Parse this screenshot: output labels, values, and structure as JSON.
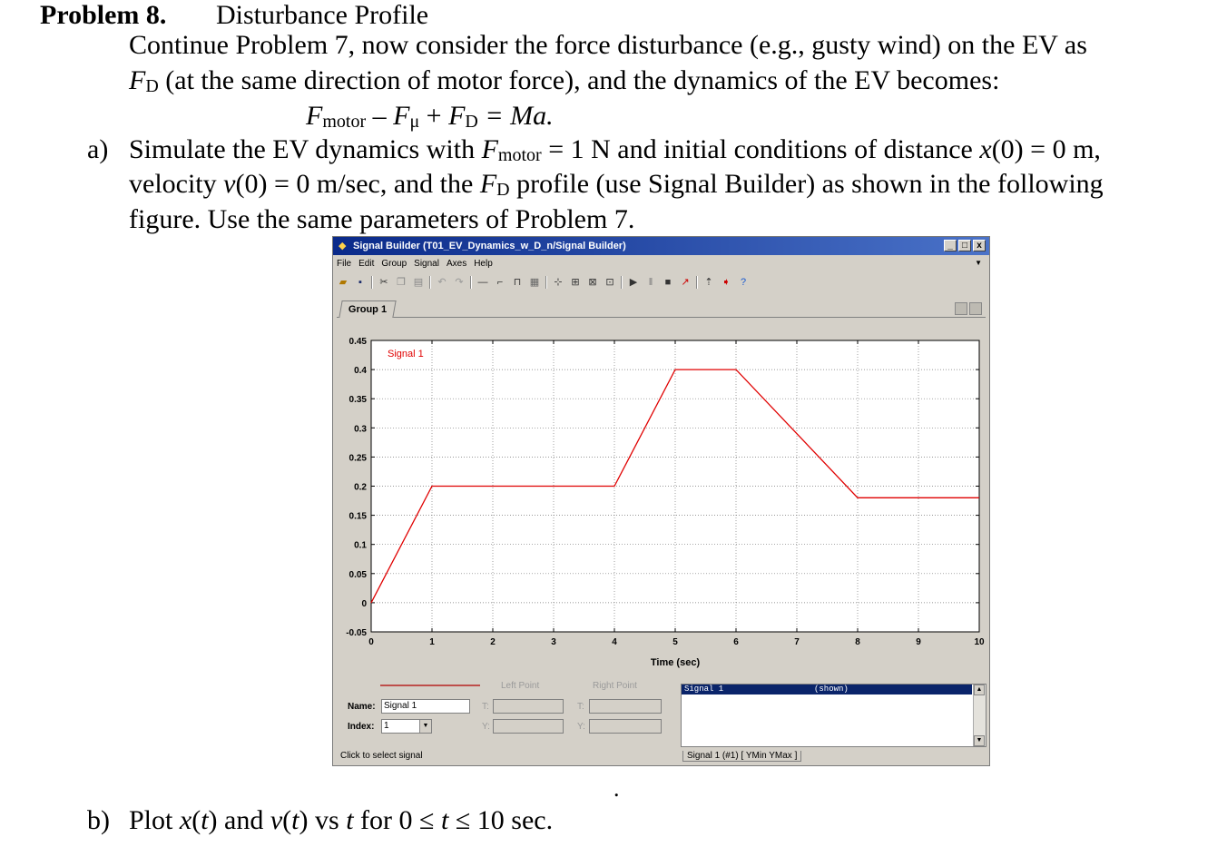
{
  "problem": {
    "number": "Problem 8.",
    "title": "Disturbance Profile",
    "intro_line1": "Continue Problem 7, now consider the force disturbance (e.g., gusty wind) on the EV as",
    "intro_line2": "(at the same direction of motor force), and the dynamics of the EV becomes:",
    "fd_symbol": "F",
    "fd_sub": "D",
    "equation": {
      "f": "F",
      "motor": "motor",
      "minus": " – ",
      "mu_sub": "μ",
      "plus": " + ",
      "rhs": " = Ma."
    },
    "part_a_label": "a)",
    "part_a_line1_pre": "Simulate the EV dynamics with ",
    "part_a_line1_mid": " = 1 N and initial conditions of distance ",
    "part_a_line1_x": "x",
    "part_a_line1_end": "(0) = 0 m,",
    "part_a_line2_v": "velocity ",
    "part_a_line2_vi": "v",
    "part_a_line2_mid": "(0) = 0 m/sec, and the ",
    "part_a_line2_end": " profile (use Signal Builder) as shown in the following",
    "part_a_line3": "figure. Use the same parameters of Problem 7.",
    "part_b_label": "b)",
    "part_b_pre": "Plot ",
    "part_b_x": "x",
    "part_b_t1": "t",
    "part_b_and": ") and ",
    "part_b_v": "v",
    "part_b_t2": "t",
    "part_b_vs": ") vs ",
    "part_b_t3": "t",
    "part_b_range_pre": " for 0 ≤ ",
    "part_b_t4": "t",
    "part_b_range_post": " ≤ 10 sec.",
    "stray_dot": "."
  },
  "window": {
    "title": "Signal Builder (T01_EV_Dynamics_w_D_n/Signal Builder)",
    "buttons": [
      "_",
      "□",
      "x"
    ],
    "menu": [
      "File",
      "Edit",
      "Group",
      "Signal",
      "Axes",
      "Help"
    ],
    "tab": "Group 1",
    "toolbar_icons": [
      "open-icon",
      "save-icon",
      "cut-icon",
      "copy-icon",
      "paste-icon",
      "undo-icon",
      "redo-icon",
      "constant-icon",
      "step-icon",
      "pulse-icon",
      "table-icon",
      "signal-add-icon",
      "signal-copy-icon",
      "signal-del-icon",
      "signal-props-icon",
      "play-icon",
      "pause-icon",
      "stop-icon",
      "scope-icon",
      "import-icon",
      "export-icon",
      "help-icon"
    ]
  },
  "chart_data": {
    "type": "line",
    "series": [
      {
        "name": "Signal 1",
        "color": "#e00000",
        "x": [
          0,
          1,
          4,
          5,
          6,
          8,
          10
        ],
        "y": [
          0,
          0.2,
          0.2,
          0.4,
          0.4,
          0.18,
          0.18
        ]
      }
    ],
    "xlabel": "Time (sec)",
    "ylabel": "",
    "xlim": [
      0,
      10
    ],
    "ylim": [
      -0.05,
      0.45
    ],
    "xticks": [
      "0",
      "1",
      "2",
      "3",
      "4",
      "5",
      "6",
      "7",
      "8",
      "9",
      "10"
    ],
    "yticks": [
      "0.45",
      "0.4",
      "0.35",
      "0.3",
      "0.25",
      "0.2",
      "0.15",
      "0.1",
      "0.05",
      "0",
      "-0.05"
    ],
    "grid": true
  },
  "panel": {
    "left_point": "Left Point",
    "right_point": "Right Point",
    "name_label": "Name:",
    "name_value": "Signal 1",
    "index_label": "Index:",
    "index_value": "1",
    "t_label": "T:",
    "y_label": "Y:",
    "list_selected_name": "Signal 1",
    "list_selected_status": "(shown)",
    "status_left": "Click to select signal",
    "status_right": "Signal 1 (#1)  [ YMin YMax ]"
  }
}
